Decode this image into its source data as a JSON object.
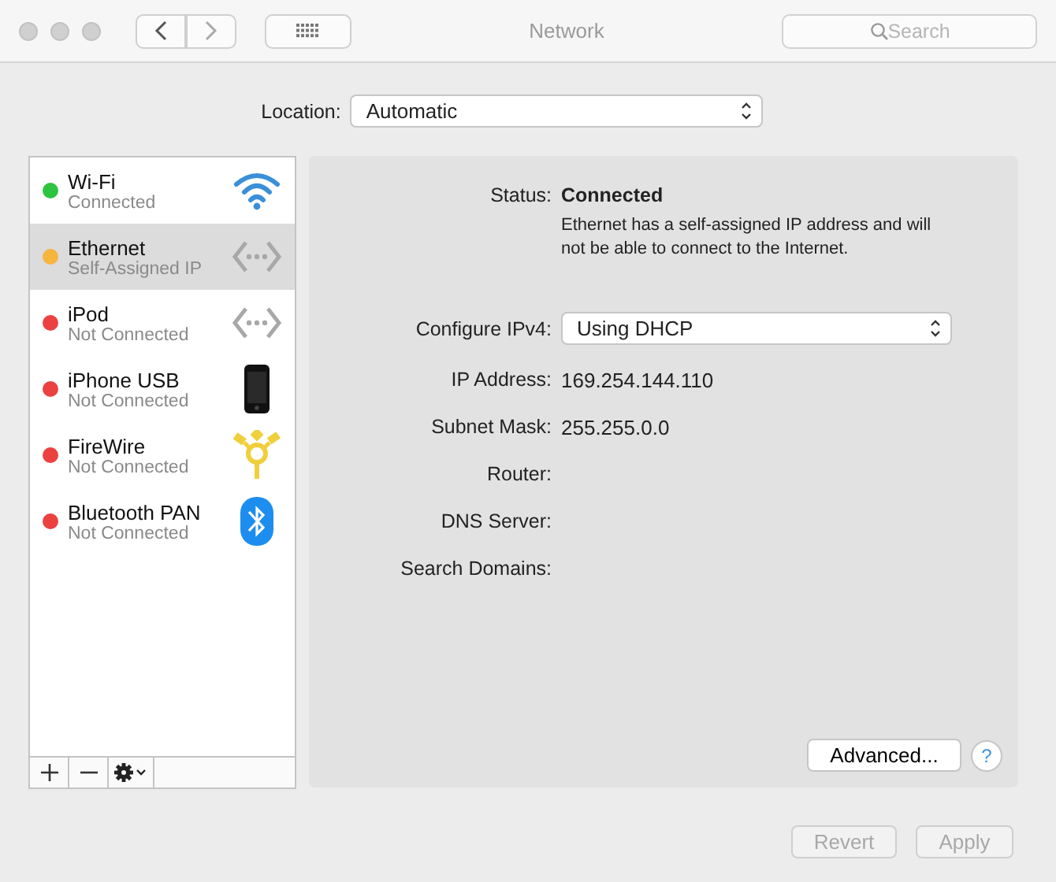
{
  "window": {
    "title": "Network"
  },
  "search": {
    "placeholder": "Search"
  },
  "location": {
    "label": "Location:",
    "value": "Automatic"
  },
  "services": [
    {
      "name": "Wi-Fi",
      "status": "Connected",
      "color": "#2ec440",
      "kind": "wifi",
      "selected": false
    },
    {
      "name": "Ethernet",
      "status": "Self-Assigned IP",
      "color": "#f5b53f",
      "kind": "ethernet",
      "selected": true
    },
    {
      "name": "iPod",
      "status": "Not Connected",
      "color": "#ec4141",
      "kind": "ethernet",
      "selected": false
    },
    {
      "name": "iPhone USB",
      "status": "Not Connected",
      "color": "#ec4141",
      "kind": "phone",
      "selected": false
    },
    {
      "name": "FireWire",
      "status": "Not Connected",
      "color": "#ec4141",
      "kind": "firewire",
      "selected": false
    },
    {
      "name": "Bluetooth PAN",
      "status": "Not Connected",
      "color": "#ec4141",
      "kind": "bluetooth",
      "selected": false
    }
  ],
  "status": {
    "label": "Status:",
    "value": "Connected",
    "note": "Ethernet has a self-assigned IP address and will not be able to connect to the Internet."
  },
  "fields": [
    {
      "kind": "popup",
      "label": "Configure IPv4:",
      "value": "Using DHCP"
    },
    {
      "kind": "text",
      "label": "IP Address:",
      "value": "169.254.144.110"
    },
    {
      "kind": "text",
      "label": "Subnet Mask:",
      "value": "255.255.0.0"
    },
    {
      "kind": "text",
      "label": "Router:"
    },
    {
      "kind": "text",
      "label": "DNS Server:"
    },
    {
      "kind": "text",
      "label": "Search Domains:"
    }
  ],
  "advanced_button": "Advanced...",
  "help_button": "?",
  "buttons": [
    {
      "label": "Revert",
      "disabled": true
    },
    {
      "label": "Apply",
      "disabled": true
    }
  ]
}
